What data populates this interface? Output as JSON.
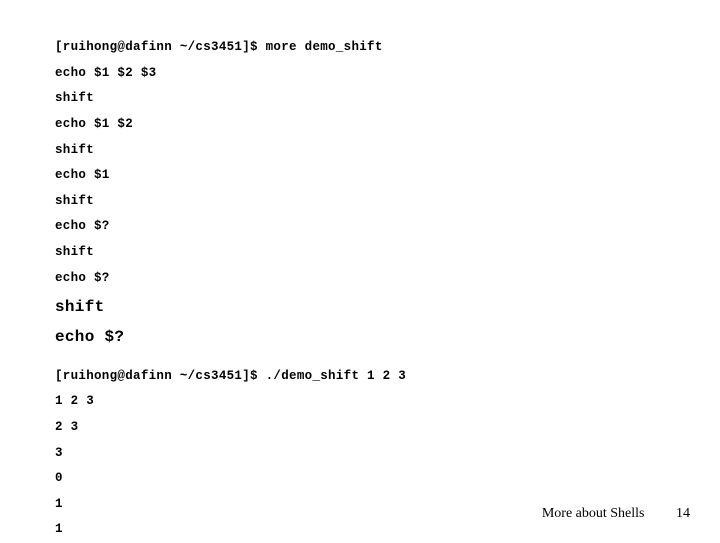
{
  "block1": {
    "l1": "[ruihong@dafinn ~/cs3451]$ more demo_shift",
    "l2": "echo $1 $2 $3",
    "l3": "shift",
    "l4": "echo $1 $2",
    "l5": "shift",
    "l6": "echo $1",
    "l7": "shift",
    "l8": "echo $?",
    "l9": "shift",
    "l10": "echo $?",
    "l11": "shift",
    "l12": "echo $?"
  },
  "block2": {
    "l1": "[ruihong@dafinn ~/cs3451]$ ./demo_shift 1 2 3",
    "l2": "1 2 3",
    "l3": "2 3",
    "l4": "3",
    "l5": "0",
    "l6": "1",
    "l7": "1"
  },
  "footer": {
    "text": "More about Shells",
    "page": "14"
  }
}
